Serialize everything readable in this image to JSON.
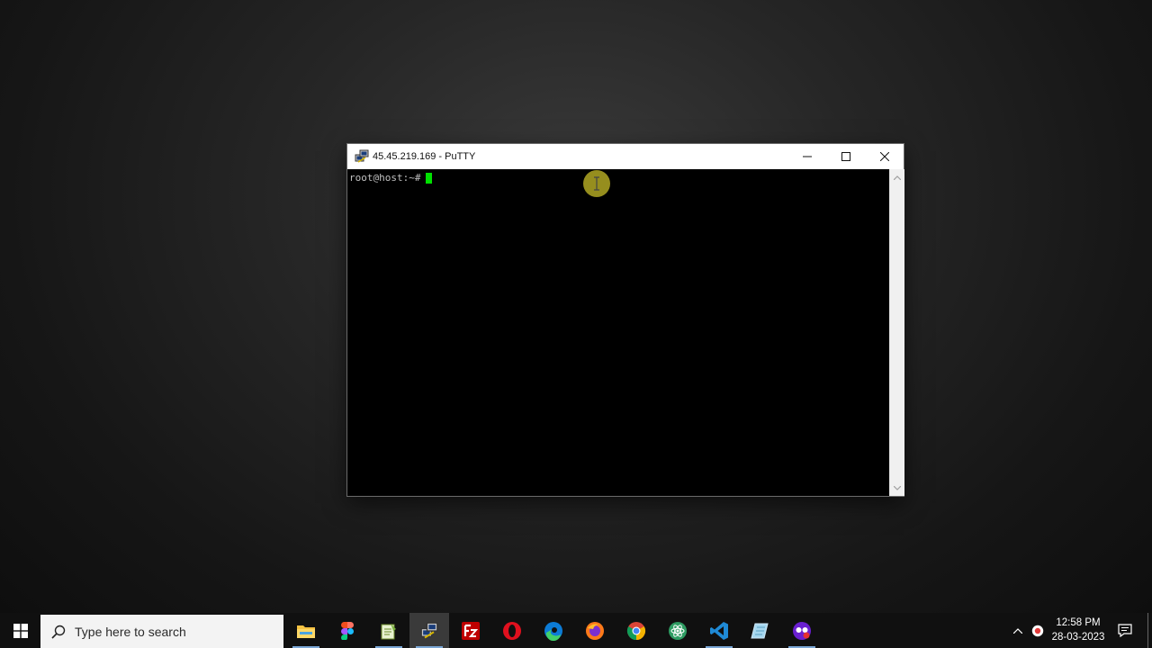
{
  "window": {
    "title": "45.45.219.169 - PuTTY",
    "minimize_label": "Minimize",
    "maximize_label": "Maximize",
    "close_label": "Close"
  },
  "terminal": {
    "prompt": "root@host:~#",
    "cursor_color": "#00e000",
    "background": "#000000"
  },
  "taskbar": {
    "search_placeholder": "Type here to search",
    "apps": [
      {
        "name": "File Explorer",
        "icon": "folder-icon"
      },
      {
        "name": "Figma",
        "icon": "figma-icon"
      },
      {
        "name": "Notepad++",
        "icon": "notepad-icon"
      },
      {
        "name": "PuTTY",
        "icon": "putty-icon",
        "active": true
      },
      {
        "name": "FileZilla",
        "icon": "filezilla-icon"
      },
      {
        "name": "Opera",
        "icon": "opera-icon"
      },
      {
        "name": "Microsoft Edge",
        "icon": "edge-icon"
      },
      {
        "name": "Firefox",
        "icon": "firefox-icon"
      },
      {
        "name": "Google Chrome",
        "icon": "chrome-icon"
      },
      {
        "name": "Atom",
        "icon": "atom-icon"
      },
      {
        "name": "Visual Studio Code",
        "icon": "vscode-icon"
      },
      {
        "name": "Notes",
        "icon": "notes-icon"
      },
      {
        "name": "Recorder",
        "icon": "recorder-icon"
      }
    ],
    "time": "12:58 PM",
    "date": "28-03-2023"
  }
}
